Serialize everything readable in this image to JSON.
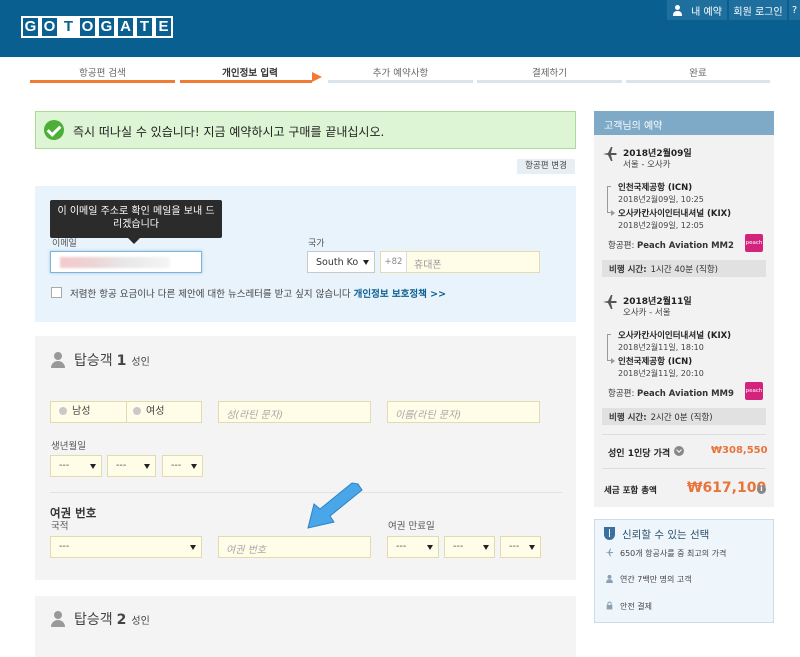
{
  "header": {
    "logo_letters": [
      "G",
      "O",
      "T",
      "O",
      "G",
      "A",
      "T",
      "E"
    ],
    "my_reservation": "내 예약",
    "member_login": "회원 로그인",
    "more": "?"
  },
  "steps": [
    {
      "label": "항공편 검색",
      "state": "done"
    },
    {
      "label": "개인정보 입력",
      "state": "active"
    },
    {
      "label": "추가 예약사항",
      "state": "todo"
    },
    {
      "label": "결제하기",
      "state": "todo"
    },
    {
      "label": "완료",
      "state": "todo"
    }
  ],
  "success_banner": "즉시 떠나실 수 있습니다! 지금 예약하시고 구매를 끝내십시오.",
  "change_flight": "항공편 변경",
  "contact": {
    "tooltip": "이 이메일 주소로 확인 메일을 보내 드리겠습니다",
    "email_label": "이메일",
    "country_label": "국가",
    "country_value": "South Ko",
    "phone_prefix": "+82",
    "phone_placeholder": "휴대폰",
    "newsletter_text": "저렴한 항공 요금이나 다른 제안에 대한 뉴스레터를 받고 싶지 않습니다",
    "privacy_link": "개인정보 보호정책 >>"
  },
  "passenger1": {
    "title": "탑승객",
    "number": "1",
    "type": "성인",
    "male": "남성",
    "female": "여성",
    "surname_placeholder": "성(라틴 문자)",
    "given_placeholder": "이름(라틴 문자)",
    "dob_label": "생년월일",
    "dob_default": "---",
    "passport_title": "여권 번호",
    "nationality_label": "국적",
    "nationality_default": "---",
    "passport_placeholder": "여권 번호",
    "expiry_label": "여권 만료일",
    "expiry_default": "---"
  },
  "passenger2": {
    "title": "탑승객",
    "number": "2",
    "type": "성인"
  },
  "sidebar": {
    "title": "고객님의 예약",
    "outbound": {
      "date": "2018년2월09일",
      "route": "서울 - 오사카",
      "dep_airport": "인천국제공항 (ICN)",
      "dep_time": "2018년2월09일, 10:25",
      "arr_airport": "오사카칸사이인터내셔널 (KIX)",
      "arr_time": "2018년2월09일, 12:05",
      "airline_label": "항공편:",
      "airline": "Peach Aviation MM2",
      "duration_label": "비행 시간:",
      "duration": "1시간 40분 (직항)"
    },
    "inbound": {
      "date": "2018년2월11일",
      "route": "오사카 - 서울",
      "dep_airport": "오사카칸사이인터내셔널 (KIX)",
      "dep_time": "2018년2월11일, 18:10",
      "arr_airport": "인천국제공항 (ICN)",
      "arr_time": "2018년2월11일, 20:10",
      "airline_label": "항공편:",
      "airline": "Peach Aviation MM9",
      "duration_label": "비행 시간:",
      "duration": "2시간 0분 (직항)"
    },
    "per_person_label": "성인 1인당 가격",
    "per_person_price": "₩308,550",
    "total_label": "세금 포함 총액",
    "total_price": "₩617,100"
  },
  "trust": {
    "title": "신뢰할 수 있는 선택",
    "items": [
      "650개 항공사를 중 최고의 가격",
      "연간 7백만 명의 고객",
      "안전 결제"
    ]
  },
  "colors": {
    "header_bg": "#0a5f91",
    "accent_orange": "#f07b33",
    "price_orange": "#e8743b",
    "success_bg": "#ddf5d5",
    "sidebar_head": "#7ea9c7"
  }
}
